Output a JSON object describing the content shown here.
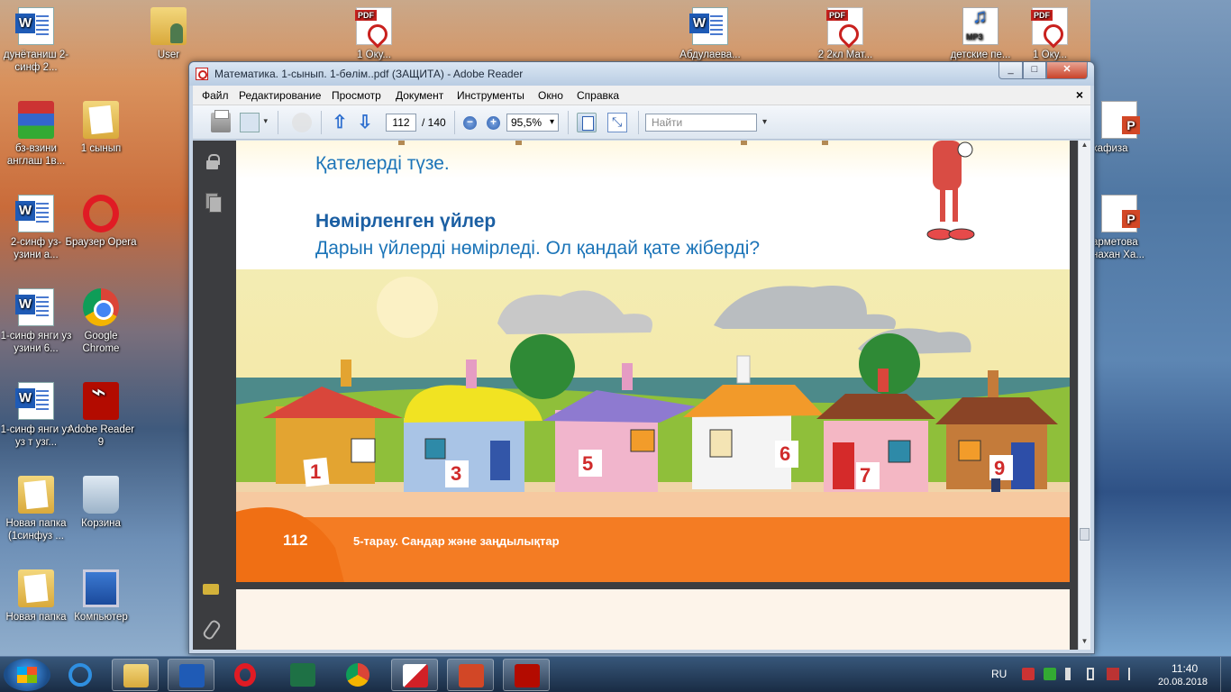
{
  "desktop": {
    "icons": [
      {
        "id": "dun",
        "label": "дунётаниш 2-синф 2...",
        "type": "word"
      },
      {
        "id": "user",
        "label": "User",
        "type": "user"
      },
      {
        "id": "pdf1",
        "label": "1 Оку...",
        "type": "pdf"
      },
      {
        "id": "w2",
        "label": "Абдулаева...",
        "type": "word"
      },
      {
        "id": "pdf2",
        "label": "2 2кл Мат...",
        "type": "pdf"
      },
      {
        "id": "mp3",
        "label": "детские пе...",
        "type": "mp3"
      },
      {
        "id": "pdf3",
        "label": "1 Оку...",
        "type": "pdf"
      },
      {
        "id": "rar",
        "label": "бз-взини англаш 1в...",
        "type": "winrar"
      },
      {
        "id": "f1",
        "label": "1 сынып",
        "type": "folder"
      },
      {
        "id": "w3",
        "label": "2-синф уз-узини а...",
        "type": "word"
      },
      {
        "id": "opera",
        "label": "Браузер Opera",
        "type": "opera"
      },
      {
        "id": "w4",
        "label": "1-синф янги уз узини 6...",
        "type": "word"
      },
      {
        "id": "chrome",
        "label": "Google Chrome",
        "type": "chrome"
      },
      {
        "id": "w5",
        "label": "1-синф янги уз уз т узг...",
        "type": "word"
      },
      {
        "id": "adobe",
        "label": "Adobe Reader 9",
        "type": "adobe"
      },
      {
        "id": "f2",
        "label": "Новая папка (1синфуз ...",
        "type": "folder"
      },
      {
        "id": "bin",
        "label": "Корзина",
        "type": "bin"
      },
      {
        "id": "f3",
        "label": "Новая папка",
        "type": "folder"
      },
      {
        "id": "pc",
        "label": "Компьютер",
        "type": "pc"
      },
      {
        "id": "ppt1",
        "label": "хафиза",
        "type": "ppt"
      },
      {
        "id": "ppt2",
        "label": "арметова нахан Ха...",
        "type": "ppt"
      }
    ]
  },
  "window": {
    "title": "Математика. 1-сынып. 1-бөлім..pdf (ЗАЩИТА) - Adobe Reader",
    "controls": {
      "minimize": "_",
      "maximize": "□",
      "close": "✕"
    },
    "menu": [
      "Файл",
      "Редактирование",
      "Просмотр",
      "Документ",
      "Инструменты",
      "Окно",
      "Справка"
    ],
    "menu_close": "×"
  },
  "toolbar": {
    "page_current": "112",
    "page_total": "/ 140",
    "zoom": "95,5%",
    "search_placeholder": "Найти",
    "prev_arrow": "⇧",
    "next_arrow": "⇩",
    "zoom_out": "−",
    "zoom_in": "+"
  },
  "document": {
    "heading_correct": "Қателерді түзе.",
    "heading_numbered": "Нөмірленген үйлер",
    "question": "Дарын үйлерді нөмірледі. Ол қандай қате жіберді?",
    "house_numbers": [
      "1",
      "3",
      "5",
      "6",
      "7",
      "9"
    ],
    "page_number": "112",
    "section_title": "5-тарау. Сандар және заңдылықтар"
  },
  "scrollbar": {
    "up": "▲",
    "down": "▼"
  },
  "taskbar": {
    "apps": [
      "ie",
      "explorer",
      "word",
      "opera",
      "excel",
      "chrome",
      "kaspersky",
      "powerpoint",
      "adobe-reader"
    ],
    "lang": "RU",
    "time": "11:40",
    "date": "20.08.2018"
  },
  "colors": {
    "heading": "#1b74b8",
    "footer": "#f47c23",
    "reader_dark": "#3c3d40"
  }
}
